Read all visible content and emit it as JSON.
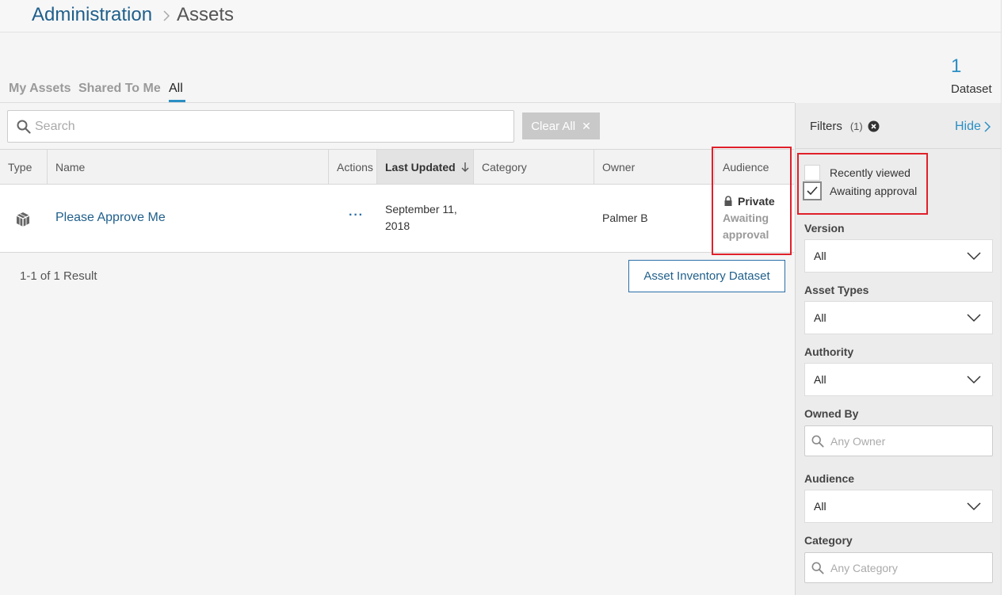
{
  "breadcrumb": {
    "parent": "Administration",
    "current": "Assets"
  },
  "tabs": [
    {
      "label": "My Assets",
      "active": false
    },
    {
      "label": "Shared To Me",
      "active": false
    },
    {
      "label": "All",
      "active": true
    }
  ],
  "dataset_summary": {
    "count": "1",
    "label": "Dataset"
  },
  "search": {
    "placeholder": "Search",
    "value": ""
  },
  "clear_all": {
    "label": "Clear All",
    "icon": "close-icon"
  },
  "table": {
    "columns": [
      "Type",
      "Name",
      "Actions",
      "Last Updated",
      "Category",
      "Owner",
      "Audience"
    ],
    "sorted_column": "Last Updated",
    "sort_direction": "descending",
    "rows": [
      {
        "type_icon": "dataset-cube-icon",
        "name": "Please Approve Me",
        "actions": "···",
        "last_updated": "September 11, 2018",
        "category": "",
        "owner": "Palmer B",
        "audience": "Private",
        "audience_icon": "lock-icon",
        "status": "Awaiting approval"
      }
    ]
  },
  "results": {
    "text": "1-1 of 1 Result"
  },
  "inventory_button": {
    "label": "Asset Inventory Dataset"
  },
  "filters": {
    "title": "Filters",
    "count": "(1)",
    "hide_label": "Hide",
    "checkboxes": [
      {
        "label": "Recently viewed",
        "checked": false
      },
      {
        "label": "Awaiting approval",
        "checked": true
      }
    ],
    "version": {
      "label": "Version",
      "value": "All"
    },
    "asset_types": {
      "label": "Asset Types",
      "value": "All"
    },
    "authority": {
      "label": "Authority",
      "value": "All"
    },
    "owned_by": {
      "label": "Owned By",
      "placeholder": "Any Owner"
    },
    "audience": {
      "label": "Audience",
      "value": "All"
    },
    "category": {
      "label": "Category",
      "placeholder": "Any Category"
    }
  },
  "colors": {
    "link": "#1f5f8b",
    "accent": "#2b8fc4",
    "highlight_box": "#e0202a"
  }
}
